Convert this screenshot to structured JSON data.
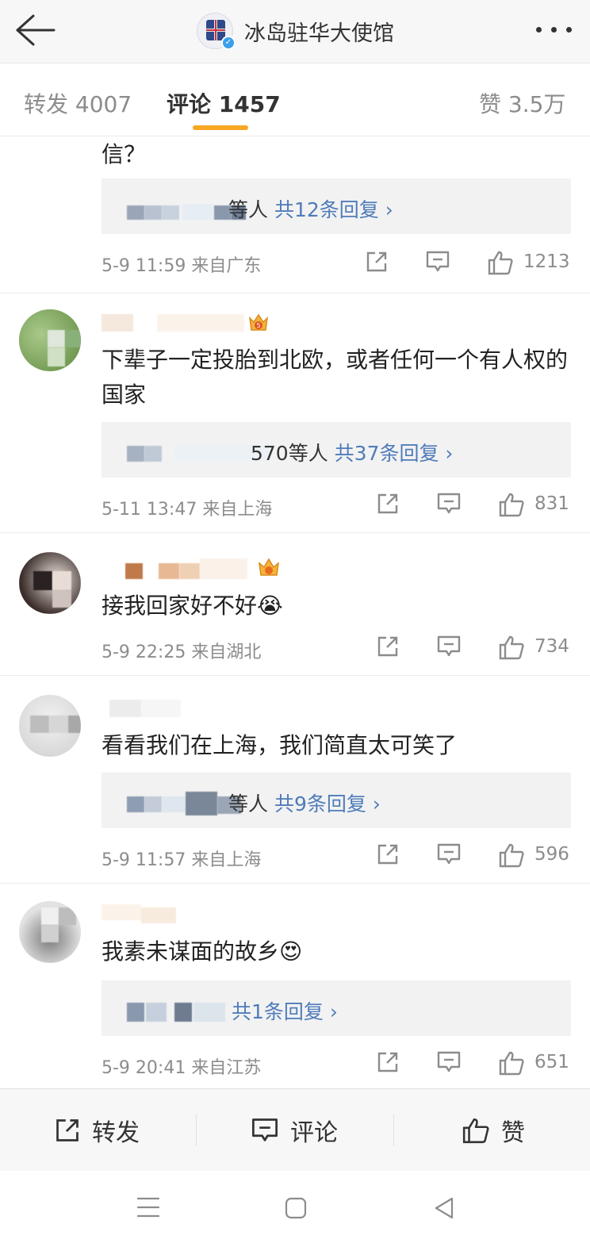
{
  "header": {
    "title": "冰岛驻华大使馆",
    "verified": true,
    "icons": [
      "back-arrow-icon",
      "more-icon"
    ]
  },
  "tabs": {
    "repost": "转发 4007",
    "comments": "评论 1457",
    "likes": "赞 3.5万",
    "active": "comments",
    "accent_color": "#f7a825"
  },
  "comments": [
    {
      "text": "信？",
      "reply_prefix": "等人",
      "reply_count": "共12条回复 ›",
      "meta": "5-9 11:59 来自广东",
      "likes": "1213"
    },
    {
      "text": "下辈子一定投胎到北欧，或者任何一个有人权的国家",
      "reply_prefix": "570等人",
      "reply_count": "共37条回复 ›",
      "meta": "5-11 13:47 来自上海",
      "likes": "831"
    },
    {
      "text": "接我回家好不好😭",
      "meta": "5-9 22:25 来自湖北",
      "likes": "734"
    },
    {
      "text": "看看我们在上海，我们简直太可笑了",
      "reply_prefix": "等人",
      "reply_count": "共9条回复 ›",
      "meta": "5-9 11:57 来自上海",
      "likes": "596"
    },
    {
      "text": "我素未谋面的故乡😍",
      "reply_prefix": "",
      "reply_count": "共1条回复 ›",
      "meta": "5-9 20:41 来自江苏",
      "likes": "651"
    }
  ],
  "toolbar": {
    "repost": "转发",
    "comment": "评论",
    "like": "赞"
  },
  "link_color": "#4f7cba"
}
